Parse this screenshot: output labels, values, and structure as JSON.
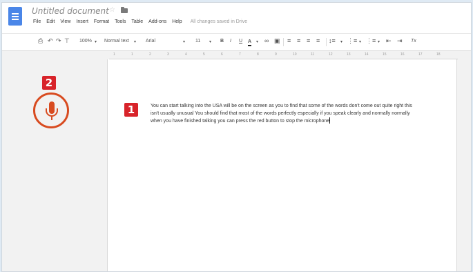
{
  "document": {
    "title": "Untitled document",
    "saved_status": "All changes saved in Drive"
  },
  "menu": [
    "File",
    "Edit",
    "View",
    "Insert",
    "Format",
    "Tools",
    "Table",
    "Add-ons",
    "Help"
  ],
  "toolbar": {
    "zoom": "100%",
    "style": "Normal text",
    "font": "Arial",
    "size": "11",
    "bold": "B",
    "italic": "I",
    "underline": "U",
    "text_color": "A",
    "line_spacing_label": "1",
    "clear": "Tx"
  },
  "ruler_ticks": [
    "1",
    "1",
    "2",
    "3",
    "4",
    "5",
    "6",
    "7",
    "8",
    "9",
    "10",
    "11",
    "12",
    "13",
    "14",
    "15",
    "16",
    "17",
    "18"
  ],
  "badges": {
    "one": "1",
    "two": "2"
  },
  "body_text": "You can start talking into the USA will be on the screen as you to find that some of the words don't come out quite right this isn't usually unusual You should find that most of the words perfectly especially if you speak clearly and normally normally when you have finished talking you can press the red button to stop the microphone",
  "colors": {
    "accent_red": "#d8232a",
    "mic_orange": "#d84b20",
    "docs_blue": "#4a86e8"
  }
}
